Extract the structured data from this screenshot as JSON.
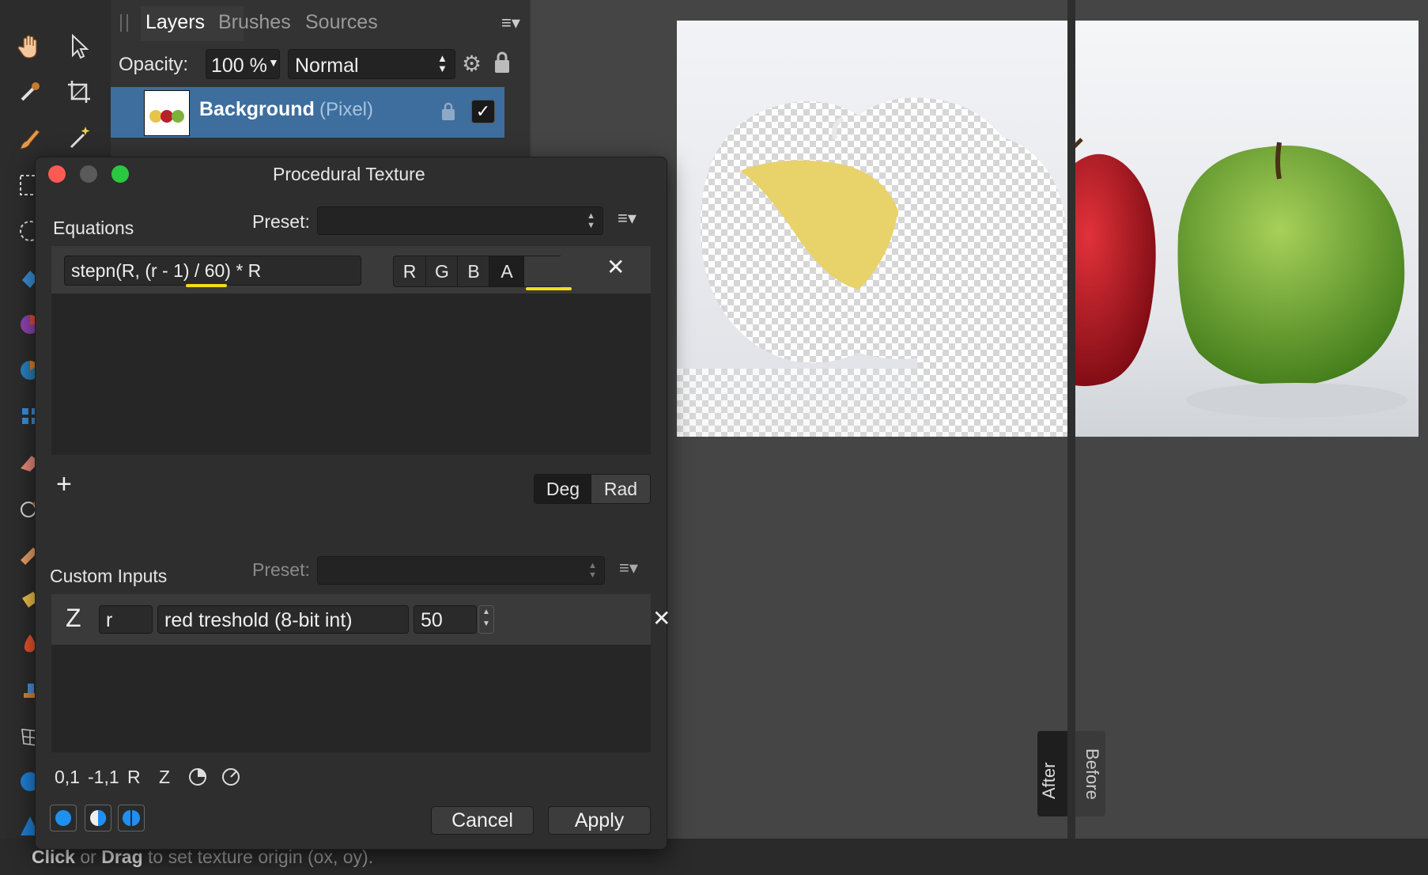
{
  "layers_panel": {
    "tabs": [
      "Layers",
      "Brushes",
      "Sources"
    ],
    "opacity_label": "Opacity:",
    "opacity_value": "100 %",
    "blend_mode": "Normal",
    "layer": {
      "name": "Background",
      "type": "(Pixel)",
      "visible": true
    }
  },
  "dialog": {
    "title": "Procedural Texture",
    "equations": {
      "heading": "Equations",
      "preset_label": "Preset:",
      "preset_value": "",
      "expression": "stepn(R, (r - 1) / 60) * R",
      "channels": [
        "R",
        "G",
        "B",
        "A"
      ],
      "active_channel": "A",
      "remove_glyph": "✕"
    },
    "add_glyph": "+",
    "angle_units": [
      "Deg",
      "Rad"
    ],
    "custom_inputs": {
      "heading": "Custom Inputs",
      "preset_label": "Preset:",
      "preset_value": "",
      "input": {
        "type_glyph": "Z",
        "variable": "r",
        "description": "red treshold (8-bit int)",
        "value": "50"
      },
      "remove_glyph": "✕"
    },
    "insert_tokens": [
      "0,1",
      "-1,1",
      "R",
      "Z"
    ],
    "cancel_label": "Cancel",
    "apply_label": "Apply"
  },
  "canvas": {
    "after_label": "After",
    "before_label": "Before"
  },
  "status": {
    "click": "Click",
    "or": " or ",
    "drag": "Drag",
    "rest": " to set texture origin (ox, oy)."
  },
  "colors": {
    "accent_blue": "#1f90f0",
    "selected_layer": "#3d6e9e",
    "annotation_yellow": "#f2dc1a"
  }
}
